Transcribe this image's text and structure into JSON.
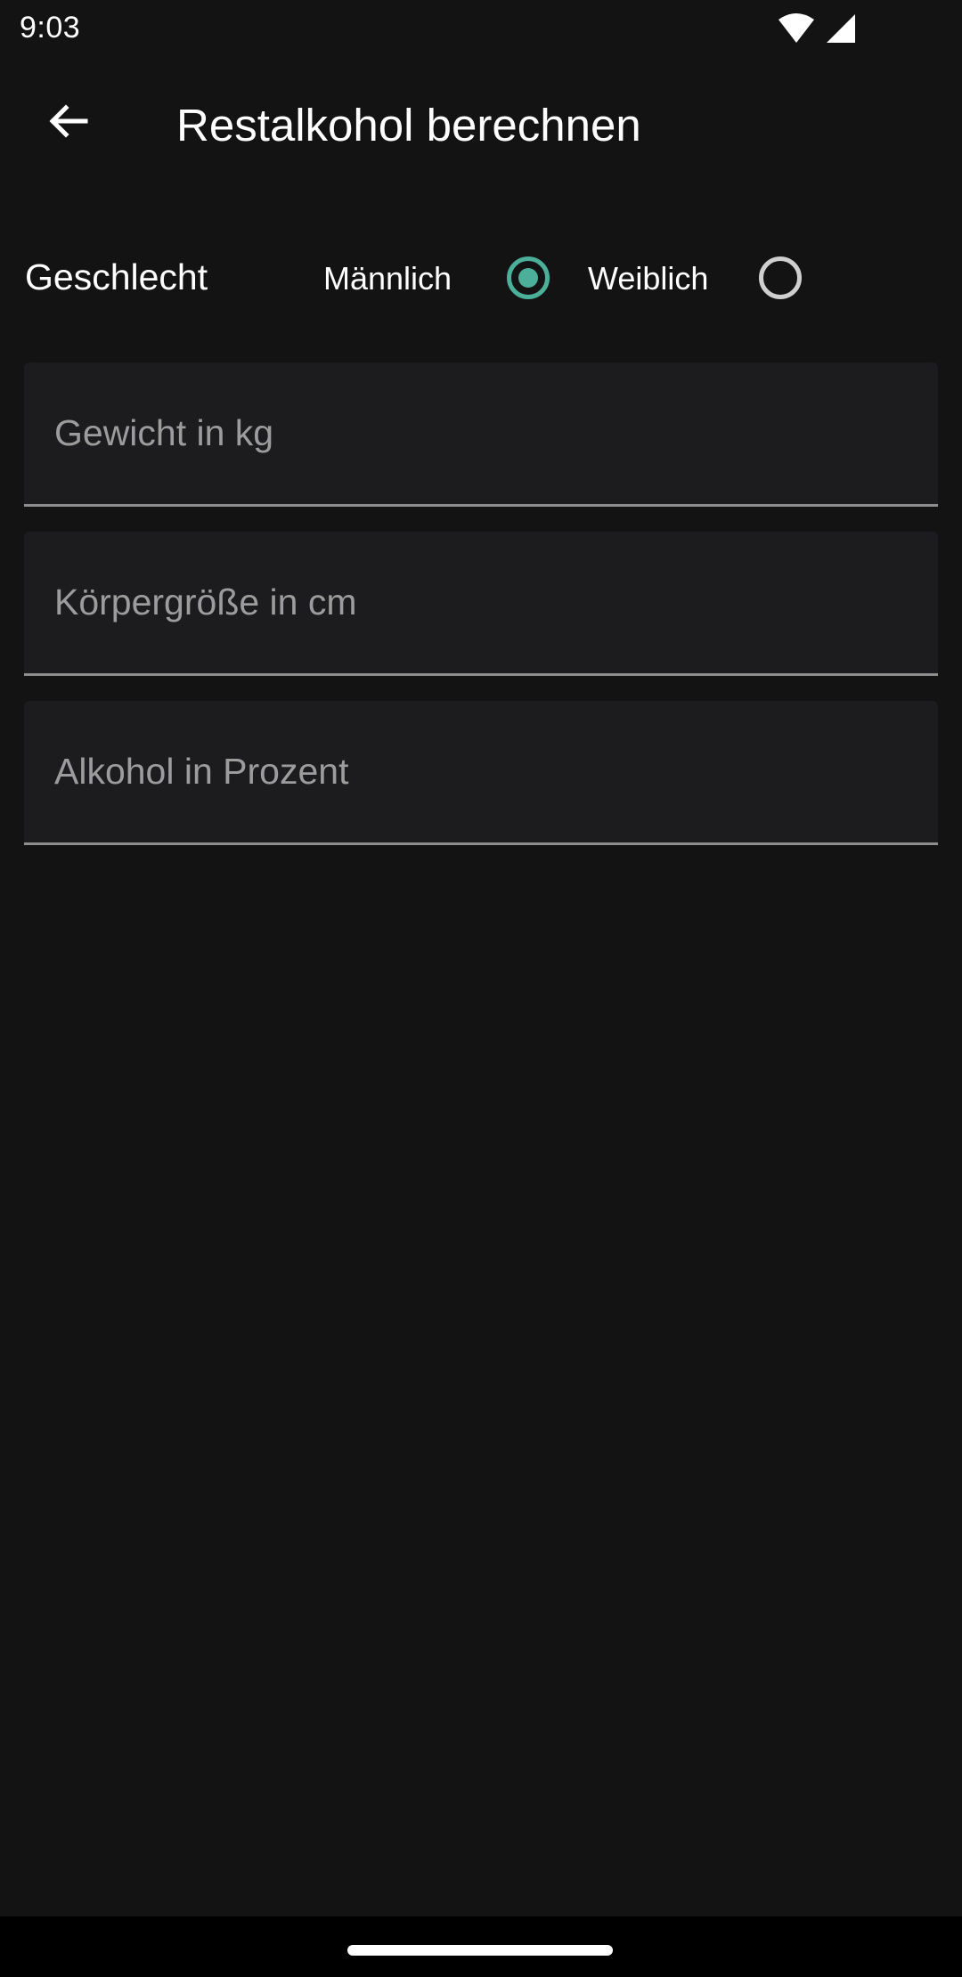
{
  "status_bar": {
    "time": "9:03",
    "icons": [
      "wifi-icon",
      "signal-icon"
    ]
  },
  "app_bar": {
    "back_icon": "arrow-back-icon",
    "title": "Restalkohol berechnen"
  },
  "gender": {
    "label": "Geschlecht",
    "options": [
      {
        "label": "Männlich",
        "selected": true
      },
      {
        "label": "Weiblich",
        "selected": false
      }
    ],
    "accent_color": "#4caf9a"
  },
  "fields": {
    "weight": {
      "placeholder": "Gewicht in kg",
      "value": ""
    },
    "height": {
      "placeholder": "Körpergröße in cm",
      "value": ""
    },
    "alcohol": {
      "placeholder": "Alkohol in Prozent",
      "value": ""
    }
  }
}
